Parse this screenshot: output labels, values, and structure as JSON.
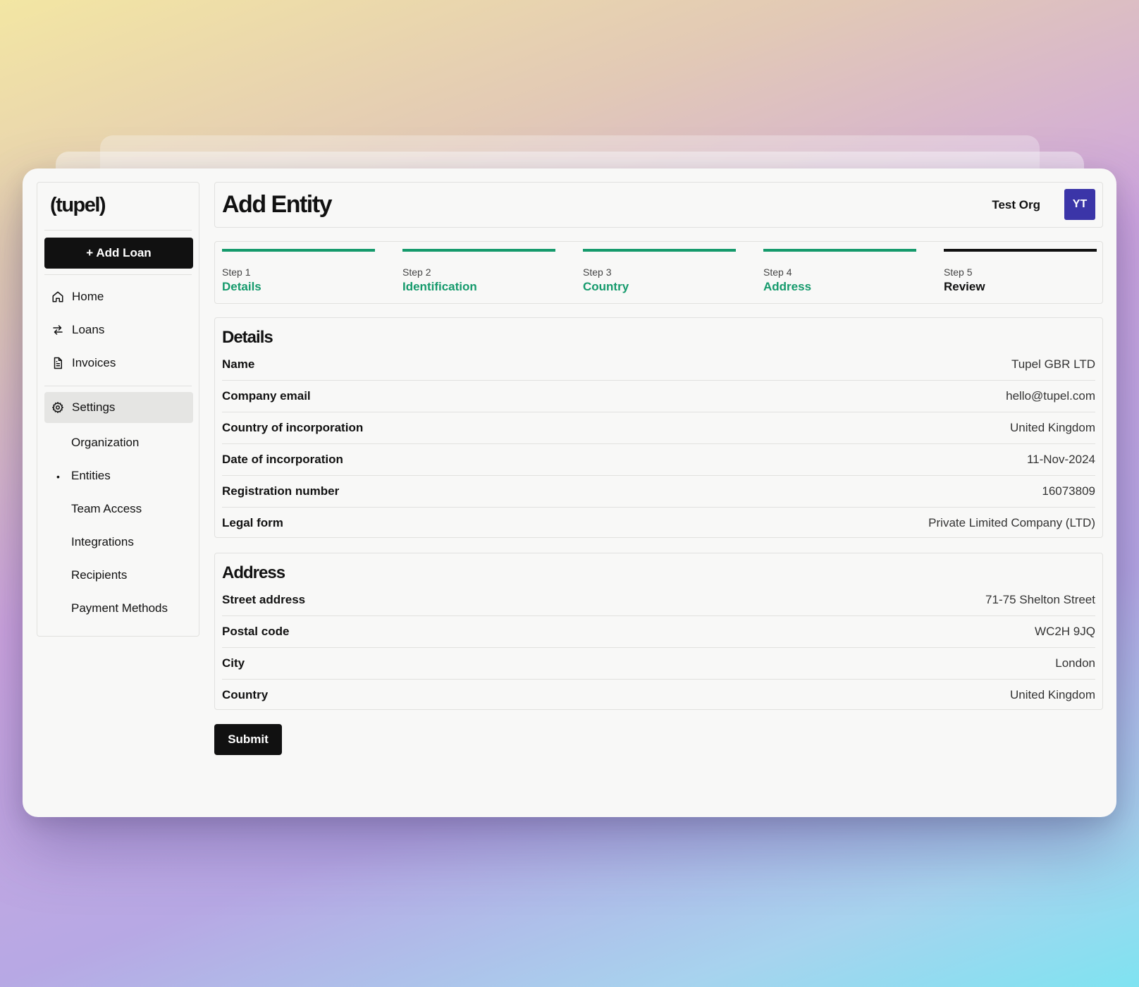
{
  "brand": {
    "logo_text": "(tupel)"
  },
  "sidebar": {
    "add_loan_label": "+ Add Loan",
    "nav": [
      {
        "label": "Home",
        "icon": "home-icon"
      },
      {
        "label": "Loans",
        "icon": "swap-arrows-icon"
      },
      {
        "label": "Invoices",
        "icon": "document-icon"
      }
    ],
    "settings": {
      "label": "Settings",
      "icon": "gear-icon"
    },
    "sub_items": [
      "Organization",
      "Entities",
      "Team Access",
      "Integrations",
      "Recipients",
      "Payment Methods"
    ],
    "bullet": "•"
  },
  "header": {
    "title": "Add Entity",
    "org_name": "Test Org",
    "avatar_initials": "YT"
  },
  "steps": [
    {
      "num": "Step 1",
      "label": "Details",
      "status": "complete"
    },
    {
      "num": "Step 2",
      "label": "Identification",
      "status": "complete"
    },
    {
      "num": "Step 3",
      "label": "Country",
      "status": "complete"
    },
    {
      "num": "Step 4",
      "label": "Address",
      "status": "complete"
    },
    {
      "num": "Step 5",
      "label": "Review",
      "status": "current"
    }
  ],
  "details": {
    "title": "Details",
    "rows": [
      {
        "key": "Name",
        "value": "Tupel GBR LTD"
      },
      {
        "key": "Company email",
        "value": "hello@tupel.com"
      },
      {
        "key": "Country of incorporation",
        "value": "United Kingdom"
      },
      {
        "key": "Date of incorporation",
        "value": "11-Nov-2024"
      },
      {
        "key": "Registration number",
        "value": "16073809"
      },
      {
        "key": "Legal form",
        "value": "Private Limited Company (LTD)"
      }
    ]
  },
  "address": {
    "title": "Address",
    "rows": [
      {
        "key": "Street address",
        "value": "71-75 Shelton Street"
      },
      {
        "key": "Postal code",
        "value": "WC2H 9JQ"
      },
      {
        "key": "City",
        "value": "London"
      },
      {
        "key": "Country",
        "value": "United Kingdom"
      }
    ]
  },
  "submit_label": "Submit",
  "colors": {
    "accent": "#159a6c",
    "avatar_bg": "#3b35a8",
    "primary_button": "#111111"
  }
}
